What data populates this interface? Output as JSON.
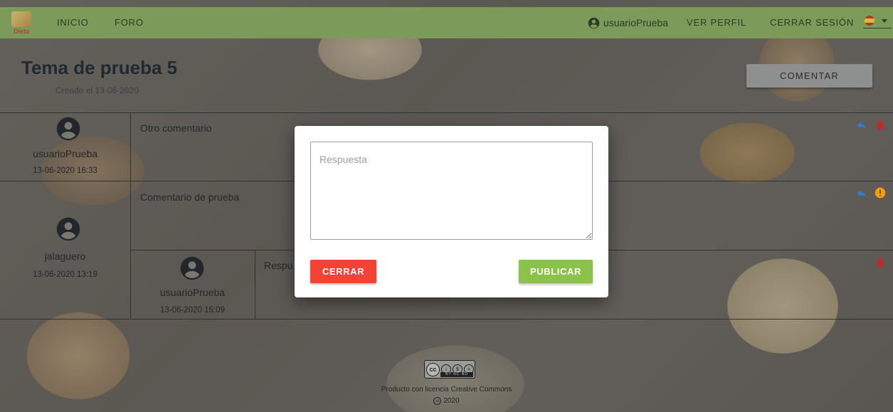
{
  "navbar": {
    "logo_text": "Dieta",
    "links": {
      "inicio": "INICIO",
      "foro": "FORO"
    },
    "username": "usuarioPrueba",
    "ver_perfil": "VER PERFIL",
    "cerrar_sesion": "CERRAR SESIÓN",
    "language_flag": "spain-flag-icon",
    "color": "#7c9a59"
  },
  "topic": {
    "title": "Tema de prueba 5",
    "created": "Creado el 13-06-2020",
    "comment_button": "COMENTAR"
  },
  "comments": [
    {
      "author": "usuarioPrueba",
      "date": "13-06-2020 16:33",
      "text": "Otro comentario",
      "actions": [
        "reply-icon",
        "delete-icon"
      ]
    },
    {
      "author": "jalaguero",
      "date": "13-06-2020 13:19",
      "text": "Comentario de prueba",
      "actions": [
        "reply-icon",
        "report-icon"
      ],
      "replies": [
        {
          "author": "usuarioPrueba",
          "date": "13-06-2020 16:09",
          "text": "Respu",
          "actions": [
            "delete-icon"
          ]
        }
      ]
    }
  ],
  "modal": {
    "placeholder": "Respuesta",
    "close_label": "CERRAR",
    "publish_label": "PUBLICAR",
    "colors": {
      "close": "#f44336",
      "publish": "#8bc34a"
    }
  },
  "footer": {
    "badge_text": "BY NC ND",
    "license_text": "Producto con licencia Creative Commons",
    "year": "2020"
  }
}
